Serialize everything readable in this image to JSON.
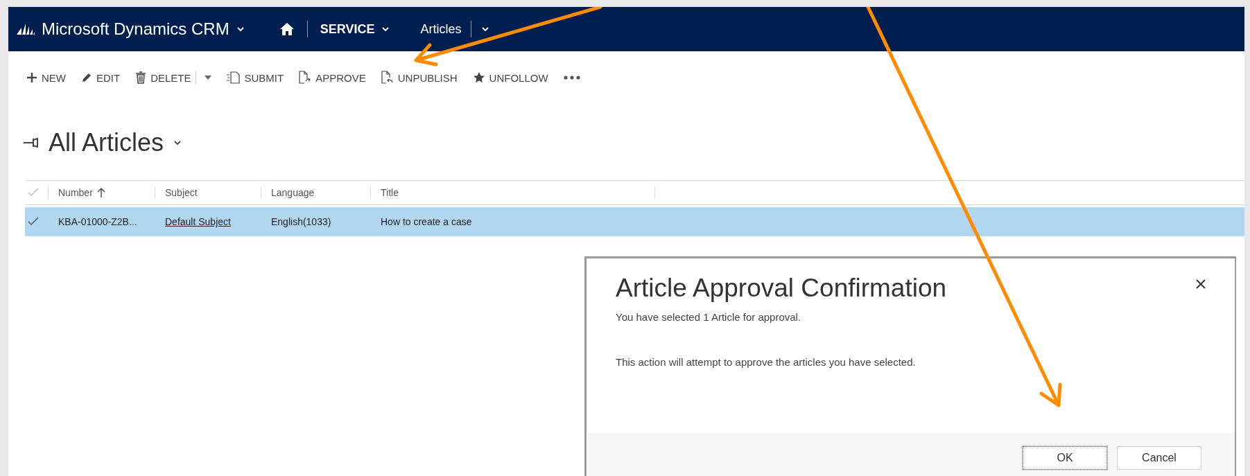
{
  "nav": {
    "brand": "Microsoft Dynamics CRM",
    "area": "SERVICE",
    "entity": "Articles"
  },
  "toolbar": {
    "buttons": [
      {
        "label": "NEW",
        "split": false
      },
      {
        "label": "EDIT",
        "split": false
      },
      {
        "label": "DELETE",
        "split": true
      },
      {
        "label": "SUBMIT",
        "split": false
      },
      {
        "label": "APPROVE",
        "split": false
      },
      {
        "label": "UNPUBLISH",
        "split": false
      },
      {
        "label": "UNFOLLOW",
        "split": false
      }
    ]
  },
  "view": {
    "title": "All Articles"
  },
  "grid": {
    "columns": [
      {
        "label": "Number",
        "sorted": true
      },
      {
        "label": "Subject",
        "sorted": false
      },
      {
        "label": "Language",
        "sorted": false
      },
      {
        "label": "Title",
        "sorted": false
      }
    ],
    "rows": [
      {
        "selected": true,
        "cells": [
          {
            "text": "KBA-01000-Z2B...",
            "kind": "text"
          },
          {
            "text": "Default Subject",
            "kind": "link"
          },
          {
            "text": "English(1033)",
            "kind": "text"
          },
          {
            "text": "How to create a case",
            "kind": "text"
          }
        ]
      }
    ]
  },
  "dialog": {
    "title": "Article Approval Confirmation",
    "lines": [
      "You have selected 1 Article for approval.",
      "This action will attempt to approve the articles you have selected."
    ],
    "buttons": [
      {
        "label": "OK",
        "focused": true
      },
      {
        "label": "Cancel",
        "focused": false
      }
    ]
  }
}
